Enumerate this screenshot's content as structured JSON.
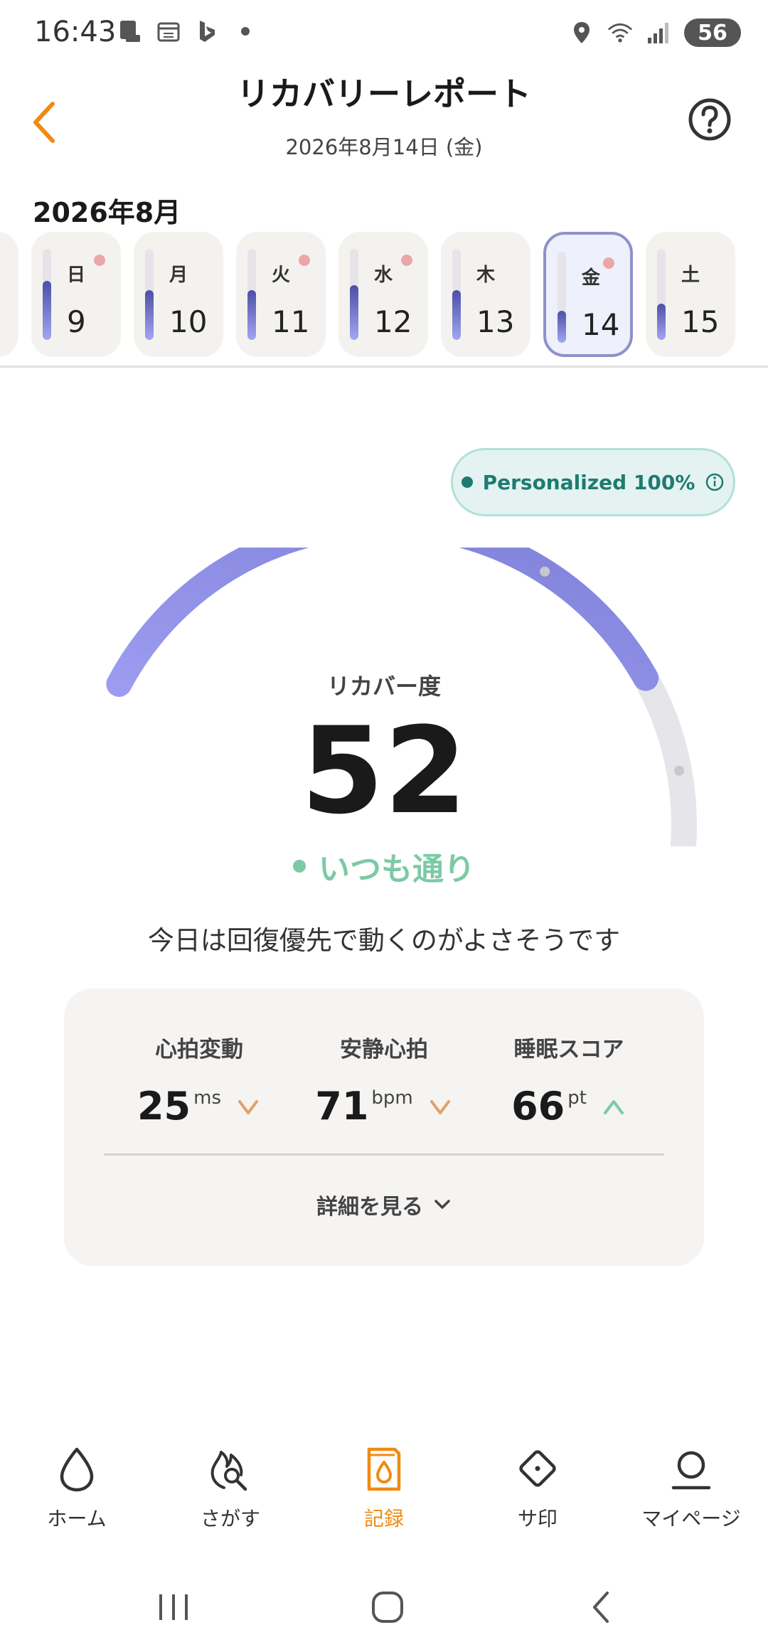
{
  "status_bar": {
    "time": "16:43",
    "battery": "56",
    "left_icons": [
      "device-icon",
      "calendar-icon",
      "bing-icon",
      "dot-icon"
    ],
    "right_icons": [
      "location-icon",
      "wifi-icon",
      "signal-icon"
    ]
  },
  "header": {
    "title": "リカバリーレポート",
    "date": "2026年8月14日 (金)"
  },
  "calendar": {
    "month_label": "2026年8月",
    "days": [
      {
        "weekday": "日",
        "date": "9",
        "level": 0.65,
        "dot": true,
        "selected": false
      },
      {
        "weekday": "月",
        "date": "10",
        "level": 0.55,
        "dot": false,
        "selected": false
      },
      {
        "weekday": "火",
        "date": "11",
        "level": 0.55,
        "dot": true,
        "selected": false
      },
      {
        "weekday": "水",
        "date": "12",
        "level": 0.6,
        "dot": true,
        "selected": false
      },
      {
        "weekday": "木",
        "date": "13",
        "level": 0.55,
        "dot": false,
        "selected": false
      },
      {
        "weekday": "金",
        "date": "14",
        "level": 0.35,
        "dot": true,
        "selected": true
      },
      {
        "weekday": "土",
        "date": "15",
        "level": 0.4,
        "dot": false,
        "selected": false
      }
    ]
  },
  "personalized_badge": {
    "text": "Personalized 100%"
  },
  "recovery": {
    "label": "リカバー度",
    "score": "52",
    "score_fraction": 0.52,
    "status": "いつも通り",
    "advice": "今日は回復優先で動くのがよさそうです",
    "colors": {
      "fill_start": "#9b9cf0",
      "fill_end": "#7e80d8",
      "track": "#e6e5ea",
      "status": "#7cc9a6"
    }
  },
  "metrics": {
    "items": [
      {
        "label": "心拍変動",
        "value": "25",
        "unit": "ms",
        "trend": "down"
      },
      {
        "label": "安静心拍",
        "value": "71",
        "unit": "bpm",
        "trend": "down"
      },
      {
        "label": "睡眠スコア",
        "value": "66",
        "unit": "pt",
        "trend": "up"
      }
    ],
    "details_label": "詳細を見る"
  },
  "bottom_nav": {
    "items": [
      {
        "label": "ホーム",
        "icon": "drop-icon",
        "active": false
      },
      {
        "label": "さがす",
        "icon": "flame-search-icon",
        "active": false
      },
      {
        "label": "記録",
        "icon": "record-book-icon",
        "active": true
      },
      {
        "label": "サ印",
        "icon": "diamond-icon",
        "active": false
      },
      {
        "label": "マイページ",
        "icon": "person-icon",
        "active": false
      }
    ]
  },
  "accent_color": "#f08a10"
}
